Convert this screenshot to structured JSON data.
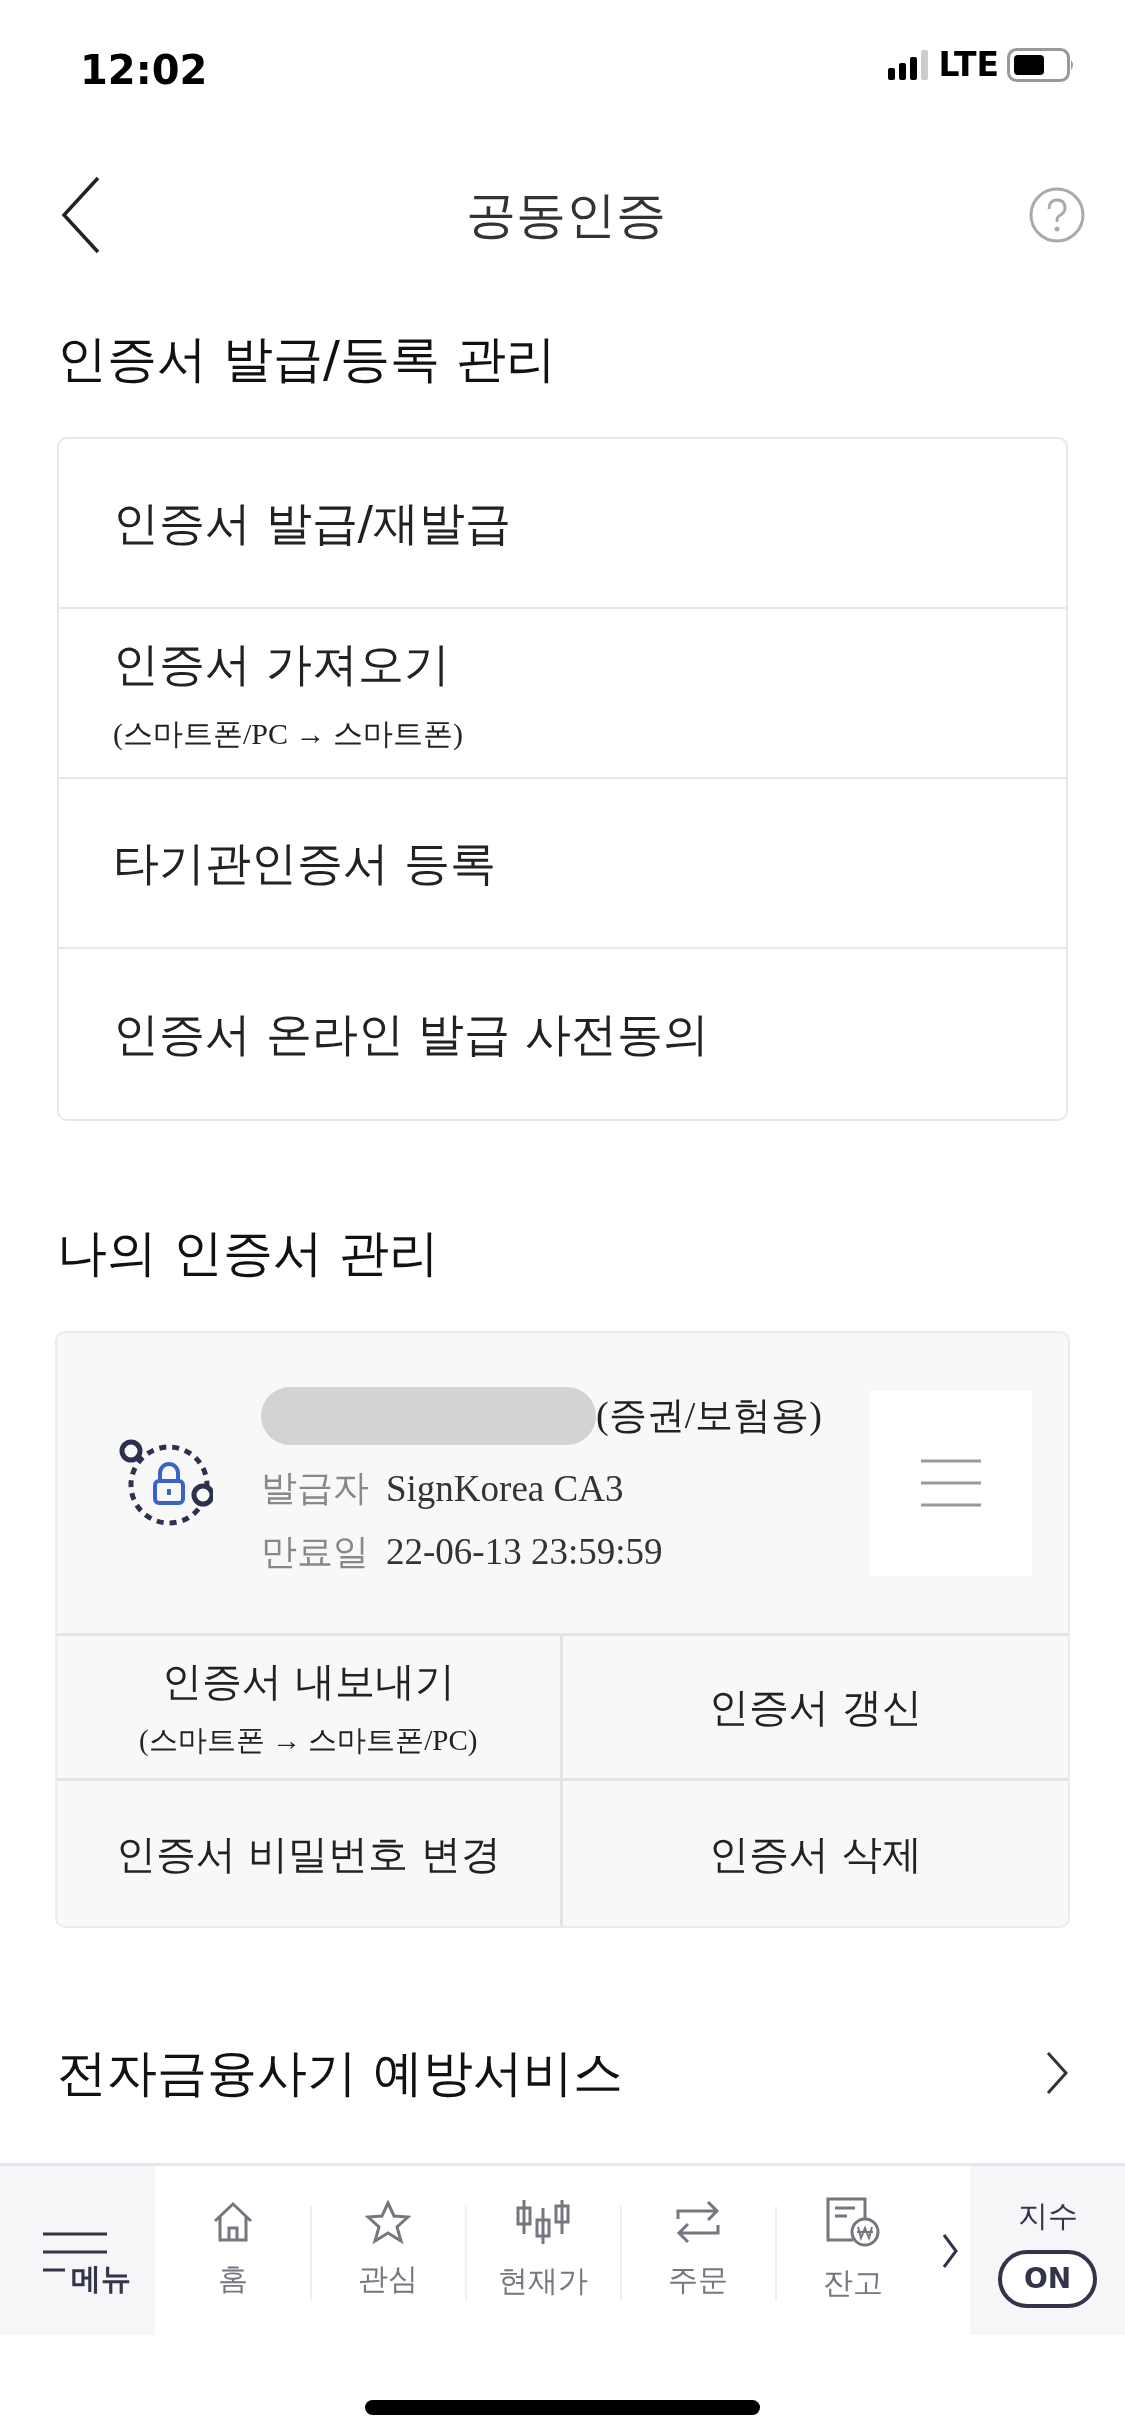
{
  "status_bar": {
    "time": "12:02",
    "network": "LTE"
  },
  "header": {
    "title": "공동인증"
  },
  "sections": [
    {
      "title": "인증서 발급/등록 관리"
    },
    {
      "title": "나의 인증서 관리"
    }
  ],
  "issue_menu": [
    {
      "label": "인증서 발급/재발급"
    },
    {
      "label": "인증서 가져오기",
      "note": "(스마트폰/PC → 스마트폰)"
    },
    {
      "label": "타기관인증서 등록"
    },
    {
      "label": "인증서 온라인 발급 사전동의"
    }
  ],
  "certificate": {
    "type": "(증권/보험용)",
    "fields": [
      {
        "label": "발급자",
        "value": "SignKorea CA3"
      },
      {
        "label": "만료일",
        "value": "22-06-13 23:59:59"
      }
    ],
    "actions": [
      {
        "label": "인증서 내보내기",
        "note": "(스마트폰 → 스마트폰/PC)"
      },
      {
        "label": "인증서 갱신"
      },
      {
        "label": "인증서 비밀번호 변경"
      },
      {
        "label": "인증서 삭제"
      }
    ]
  },
  "fraud_link": {
    "label": "전자금융사기 예방서비스"
  },
  "tab_bar": {
    "menu": "메뉴",
    "items": [
      {
        "label": "홈"
      },
      {
        "label": "관심"
      },
      {
        "label": "현재가"
      },
      {
        "label": "주문"
      },
      {
        "label": "잔고"
      }
    ],
    "index_label": "지수",
    "index_toggle": "ON"
  }
}
